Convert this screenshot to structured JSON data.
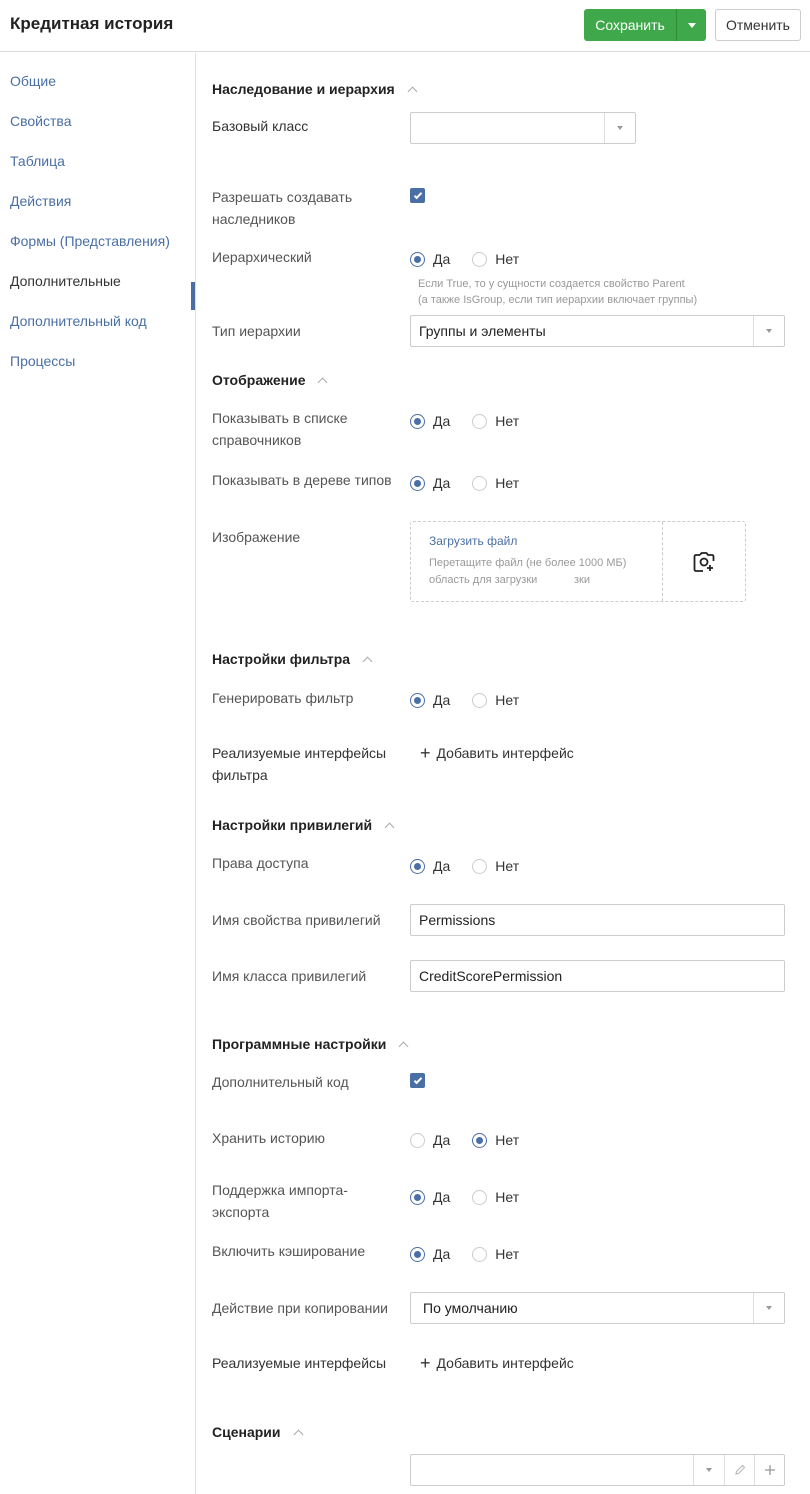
{
  "header": {
    "title": "Кредитная история",
    "save_label": "Сохранить",
    "cancel_label": "Отменить"
  },
  "sidebar": {
    "items": [
      {
        "label": "Общие"
      },
      {
        "label": "Свойства"
      },
      {
        "label": "Таблица"
      },
      {
        "label": "Действия"
      },
      {
        "label": "Формы (Представления)"
      },
      {
        "label": "Дополнительные"
      },
      {
        "label": "Дополнительный код"
      },
      {
        "label": "Процессы"
      }
    ]
  },
  "radio": {
    "yes": "Да",
    "no": "Нет"
  },
  "inheritance": {
    "title": "Наследование и иерархия",
    "base_class_label": "Базовый класс",
    "base_class_value": "",
    "allow_inherit_label": "Разрешать создавать наследников",
    "hierarchical_label": "Иерархический",
    "hierarchical_hint_1": "Если True, то у сущности создается свойство Parent",
    "hierarchical_hint_2": "(а также IsGroup, если тип иерархии включает группы)",
    "hierarchy_type_label": "Тип иерархии",
    "hierarchy_type_value": "Группы и элементы"
  },
  "display": {
    "title": "Отображение",
    "show_in_list_label": "Показывать в списке справочников",
    "show_in_tree_label": "Показывать в дереве типов",
    "image_label": "Изображение",
    "upload_link": "Загрузить файл",
    "upload_desc_1": "Перетащите файл (не более 1000 МБ)",
    "upload_desc_2": "область для загрузки            зки"
  },
  "filter": {
    "title": "Настройки фильтра",
    "generate_label": "Генерировать фильтр",
    "interfaces_label": "Реализуемые интерфейсы фильтра",
    "add_interface": "Добавить интерфейс"
  },
  "privileges": {
    "title": "Настройки привилегий",
    "access_label": "Права доступа",
    "prop_name_label": "Имя свойства привилегий",
    "prop_name_value": "Permissions",
    "class_name_label": "Имя класса привилегий",
    "class_name_value": "CreditScorePermission"
  },
  "program": {
    "title": "Программные настройки",
    "extra_code_label": "Дополнительный код",
    "history_label": "Хранить историю",
    "import_export_label": "Поддержка импорта-экспорта",
    "caching_label": "Включить кэширование",
    "copy_action_label": "Действие при копировании",
    "copy_action_value": "По умолчанию",
    "interfaces_label": "Реализуемые интерфейсы",
    "add_interface": "Добавить интерфейс"
  },
  "scenarios": {
    "title": "Сценарии",
    "value": ""
  },
  "colors": {
    "accent": "#4a6fa5",
    "save": "#3fa84a"
  }
}
